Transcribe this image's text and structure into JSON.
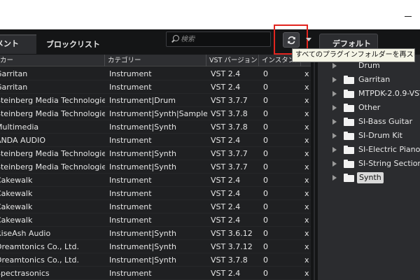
{
  "tabs": {
    "plugins": "メント",
    "blocklist": "ブロックリスト",
    "default": "デフォルト"
  },
  "search": {
    "placeholder": "検索"
  },
  "tooltip": "すべてのプラグインフォルダーを再スキャン",
  "table": {
    "headers": [
      "カー",
      "カテゴリー",
      "VST バージョン",
      "インスタンス",
      ""
    ],
    "rows": [
      [
        "Garritan",
        "Instrument",
        "VST 2.4",
        "0",
        "x"
      ],
      [
        "Garritan",
        "Instrument",
        "VST 2.4",
        "0",
        "x"
      ],
      [
        "Steinberg Media Technologies",
        "Instrument|Drum",
        "VST 3.7.7",
        "0",
        "x"
      ],
      [
        "Steinberg Media Technologies",
        "Instrument|Synth|Sampler",
        "VST 3.7.8",
        "0",
        "x"
      ],
      [
        "Multimedia",
        "Instrument|Synth",
        "VST 3.7.8",
        "0",
        "x"
      ],
      [
        "ANDA AUDIO",
        "Instrument",
        "VST 2.4",
        "0",
        "x"
      ],
      [
        "Steinberg Media Technologies",
        "Instrument|Synth",
        "VST 3.7.7",
        "0",
        "x"
      ],
      [
        "Steinberg Media Technologies",
        "Instrument|Synth",
        "VST 3.7.7",
        "0",
        "x"
      ],
      [
        "Cakewalk",
        "Instrument",
        "VST 2.4",
        "0",
        "x"
      ],
      [
        "Cakewalk",
        "Instrument",
        "VST 2.4",
        "0",
        "x"
      ],
      [
        "Cakewalk",
        "Instrument",
        "VST 2.4",
        "0",
        "x"
      ],
      [
        "Cakewalk",
        "Instrument",
        "VST 2.4",
        "0",
        "x"
      ],
      [
        "RiseAsh Audio",
        "Instrument|Synth",
        "VST 3.6.12",
        "0",
        "x"
      ],
      [
        "Dreamtonics Co., Ltd.",
        "Instrument|Synth",
        "VST 3.7.12",
        "0",
        "x"
      ],
      [
        "Dreamtonics Co., Ltd.",
        "Instrument|Synth",
        "VST 3.7.8",
        "0",
        "x"
      ],
      [
        "Spectrasonics",
        "Instrument",
        "VST 2.4",
        "0",
        "x"
      ]
    ]
  },
  "tree": {
    "items": [
      {
        "label": "Drum",
        "folder": false,
        "selected": false
      },
      {
        "label": "Garritan",
        "folder": true,
        "selected": false
      },
      {
        "label": "MTPDK-2.0.9-VST",
        "folder": true,
        "selected": false
      },
      {
        "label": "Other",
        "folder": true,
        "selected": false
      },
      {
        "label": "SI-Bass Guitar",
        "folder": true,
        "selected": false
      },
      {
        "label": "SI-Drum Kit",
        "folder": true,
        "selected": false
      },
      {
        "label": "SI-Electric Piano",
        "folder": true,
        "selected": false
      },
      {
        "label": "SI-String Section",
        "folder": true,
        "selected": false
      },
      {
        "label": "Synth",
        "folder": true,
        "selected": true
      }
    ]
  },
  "colors": {
    "highlight": "#e2251f",
    "panel": "#2b2c2f",
    "background": "#1b1c1e"
  },
  "icons": [
    "minimize-icon",
    "search-icon",
    "refresh-icon",
    "chevron-down-icon",
    "tree-arrow-icon",
    "folder-icon"
  ]
}
